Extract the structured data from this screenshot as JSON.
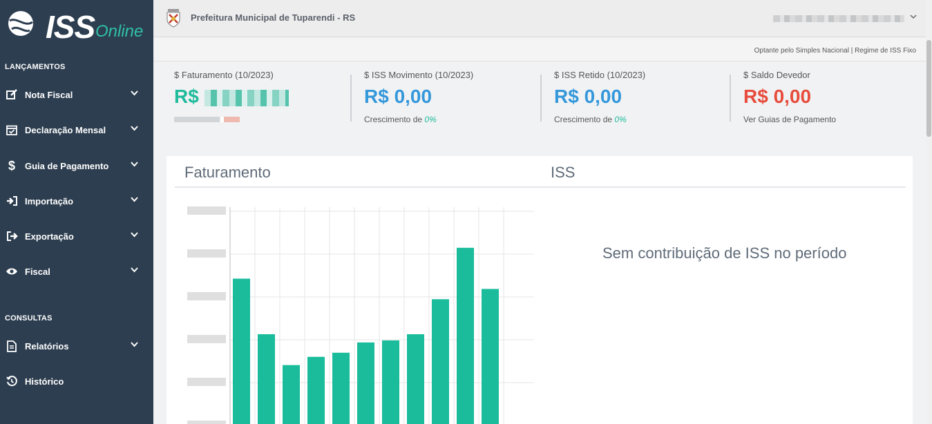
{
  "app": {
    "logo_iss": "ISS",
    "logo_online": "Online"
  },
  "header": {
    "org_name": "Prefeitura Municipal de Tuparendi - RS",
    "regime": "Optante pelo Simples Nacional | Regime de ISS Fixo"
  },
  "sidebar": {
    "sections": [
      {
        "label": "LANÇAMENTOS"
      },
      {
        "label": "CONSULTAS"
      }
    ],
    "items": [
      {
        "label": "Nota Fiscal",
        "icon": "edit-icon",
        "expandable": true
      },
      {
        "label": "Declaração Mensal",
        "icon": "calendar-check-icon",
        "expandable": true
      },
      {
        "label": "Guia de Pagamento",
        "icon": "dollar-icon",
        "expandable": true
      },
      {
        "label": "Importação",
        "icon": "sign-in-icon",
        "expandable": true
      },
      {
        "label": "Exportação",
        "icon": "sign-out-icon",
        "expandable": true
      },
      {
        "label": "Fiscal",
        "icon": "eye-icon",
        "expandable": true
      },
      {
        "label": "Relatórios",
        "icon": "file-icon",
        "expandable": true
      },
      {
        "label": "Histórico",
        "icon": "history-icon",
        "expandable": false
      }
    ]
  },
  "stats": [
    {
      "label": "$ Faturamento (10/2023)",
      "value": "R$",
      "color": "#1fbb9b",
      "footer": ""
    },
    {
      "label": "$ ISS Movimento (10/2023)",
      "value": "R$ 0,00",
      "color": "#3498db",
      "footer": "Crescimento de",
      "footer_pct": "0%"
    },
    {
      "label": "$ ISS Retido (10/2023)",
      "value": "R$ 0,00",
      "color": "#3498db",
      "footer": "Crescimento de",
      "footer_pct": "0%"
    },
    {
      "label": "$ Saldo Devedor",
      "value": "R$ 0,00",
      "color": "#e74c3c",
      "footer": "Ver Guias de Pagamento"
    }
  ],
  "panel": {
    "title_left": "Faturamento",
    "title_right": "ISS",
    "no_iss_message": "Sem contribuição de ISS no período"
  },
  "chart_data": {
    "type": "bar",
    "bar_color": "#1abc9c",
    "values": [
      0.76,
      0.49,
      0.34,
      0.38,
      0.4,
      0.45,
      0.46,
      0.49,
      0.66,
      0.91,
      0.71
    ],
    "value_scale_note": "",
    "ylim": [
      0,
      1.0
    ],
    "grid": true
  }
}
